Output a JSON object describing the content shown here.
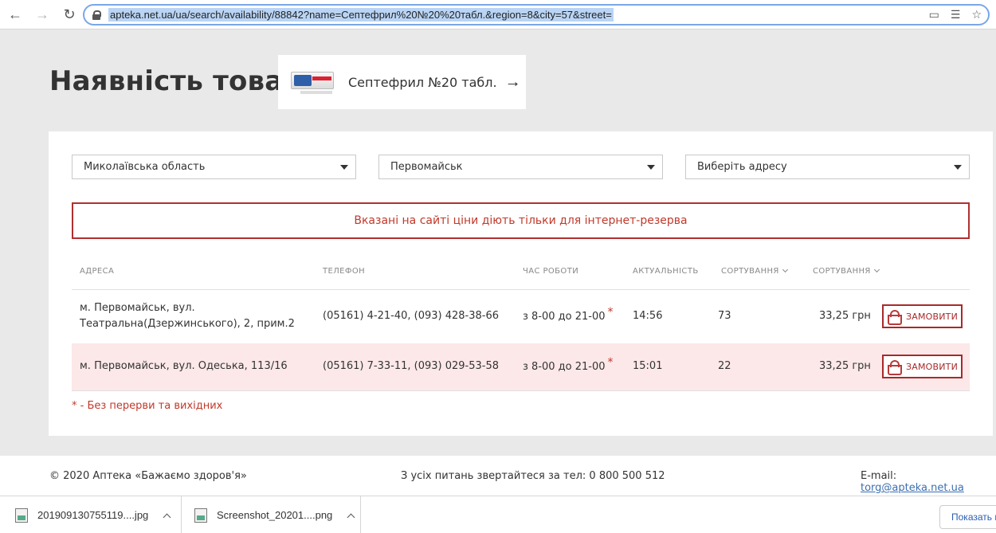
{
  "browser": {
    "url": "apteka.net.ua/ua/search/availability/88842?name=Септефрил%20№20%20табл.&region=8&city=57&street="
  },
  "header": {
    "title": "Наявність товару",
    "product_name": "Септефрил №20 табл."
  },
  "filters": {
    "region": "Миколаївська область",
    "city": "Первомайськ",
    "address": "Виберіть адресу"
  },
  "notice": "Вказані на сайті ціни діють тільки для інтернет-резерва",
  "table": {
    "columns": {
      "address": "Адреса",
      "phone": "Телефон",
      "hours": "Час роботи",
      "updated": "Актуальність",
      "sort1": "Сортування",
      "sort2": "Сортування"
    },
    "rows": [
      {
        "address_line1": "м. Первомайськ, вул.",
        "address_line2": "Театральна(Дзержинського), 2, прим.2",
        "phone": "(05161) 4-21-40, (093) 428-38-66",
        "hours": "з 8-00 до 21-00",
        "star": "*",
        "updated": "14:56",
        "quantity": "73",
        "price": "33,25 грн",
        "order_label": "ЗАМОВИТИ"
      },
      {
        "address_line1": "м. Первомайськ, вул. Одеська, 113/16",
        "address_line2": "",
        "phone": "(05161) 7-33-11, (093) 029-53-58",
        "hours": "з 8-00 до 21-00",
        "star": "*",
        "updated": "15:01",
        "quantity": "22",
        "price": "33,25 грн",
        "order_label": "ЗАМОВИТИ"
      }
    ]
  },
  "footnote": "* - Без перерви та вихідних",
  "footer": {
    "copyright": "© 2020 Аптека «Бажаємо здоров'я»",
    "contact": "З усіх питань звертайтеся за тел: 0 800 500 512",
    "email_label": "E-mail:",
    "email": "torg@apteka.net.ua"
  },
  "downloads": {
    "items": [
      {
        "name": "201909130755119....jpg"
      },
      {
        "name": "Screenshot_20201....png"
      }
    ],
    "show_all": "Показать все"
  },
  "colors": {
    "accent": "#a82a2a",
    "highlight_row": "#fce8e8",
    "link": "#3c6fb0"
  }
}
